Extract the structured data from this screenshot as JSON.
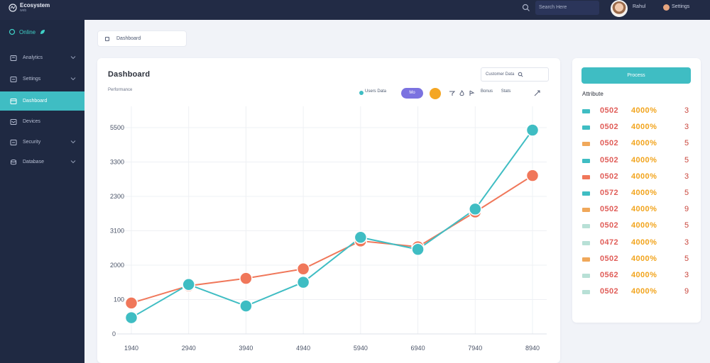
{
  "topbar": {
    "brand_name": "Ecosystem",
    "brand_sub": "web",
    "search_placeholder": "Search Here",
    "user_name": "Rahul",
    "user2_name": "Settings"
  },
  "sidebar": {
    "status_label": "Online",
    "items": [
      {
        "label": "Analytics",
        "active": false
      },
      {
        "label": "Settings",
        "active": false
      },
      {
        "label": "Dashboard",
        "active": true
      },
      {
        "label": "Devices",
        "active": false
      },
      {
        "label": "Security",
        "active": false
      },
      {
        "label": "Database",
        "active": false
      }
    ]
  },
  "breadcrumb": {
    "label": "Dashboard"
  },
  "chart_panel": {
    "title": "Dashboard",
    "subtitle": "Performance",
    "search_label": "Customer Data",
    "legend_label": "Users Data",
    "pill_label": "Mo",
    "tools_label": "Bonus",
    "tools_label2": "Stats"
  },
  "chart_data": {
    "type": "line",
    "x": [
      "1940",
      "2940",
      "3940",
      "4940",
      "5940",
      "6940",
      "7940",
      "8940"
    ],
    "series": [
      {
        "values": [
          50,
          152,
          86,
          159,
          297,
          260,
          384,
          627
        ],
        "color": "#3fbdc3"
      },
      {
        "values": [
          95,
          148,
          171,
          200,
          286,
          268,
          375,
          487
        ],
        "color": "#f0775a"
      }
    ],
    "yticks": [
      "0",
      "100",
      "2000",
      "3100",
      "2300",
      "3300",
      "5500"
    ],
    "ylim": [
      0,
      700
    ],
    "grid": true
  },
  "side_panel": {
    "button_label": "Process",
    "header": "Attribute",
    "rows": [
      {
        "code": "0502",
        "value": "4000%",
        "num": "3",
        "icon_color": "#3fbdc3"
      },
      {
        "code": "0502",
        "value": "4000%",
        "num": "3",
        "icon_color": "#3fbdc3"
      },
      {
        "code": "0502",
        "value": "4000%",
        "num": "5",
        "icon_color": "#f0a85a"
      },
      {
        "code": "0502",
        "value": "4000%",
        "num": "5",
        "icon_color": "#3fbdc3"
      },
      {
        "code": "0502",
        "value": "4000%",
        "num": "3",
        "icon_color": "#f0775a"
      },
      {
        "code": "0572",
        "value": "4000%",
        "num": "5",
        "icon_color": "#3fbdc3"
      },
      {
        "code": "0502",
        "value": "4000%",
        "num": "9",
        "icon_color": "#f0a85a"
      },
      {
        "code": "0502",
        "value": "4000%",
        "num": "5",
        "icon_color": "#b8e0d6"
      },
      {
        "code": "0472",
        "value": "4000%",
        "num": "3",
        "icon_color": "#b8e0d6"
      },
      {
        "code": "0502",
        "value": "4000%",
        "num": "5",
        "icon_color": "#f0a85a"
      },
      {
        "code": "0562",
        "value": "4000%",
        "num": "3",
        "icon_color": "#b8e0d6"
      },
      {
        "code": "0502",
        "value": "4000%",
        "num": "9",
        "icon_color": "#b8e0d6"
      }
    ]
  }
}
